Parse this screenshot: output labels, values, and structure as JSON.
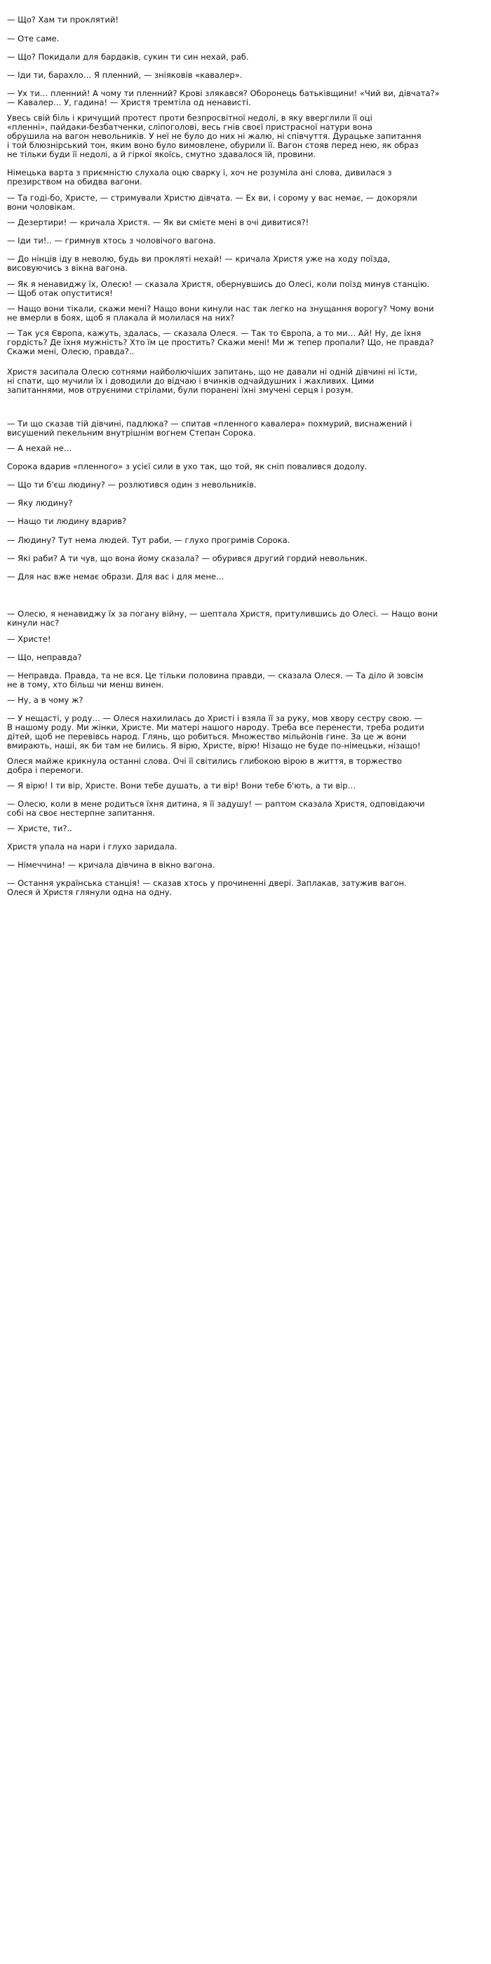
{
  "paragraphs": [
    "— Що? Хам ти проклятий!",
    "— Оте саме.",
    "— Що? Покидали для бардаків, сукин ти син нехай, раб.",
    "— Іди ти, барахло… Я пленний, — зніяковів «кавалер».",
    "— Ух ти… пленний! А чому ти пленний? Крові злякався? Оборонець батьківщини! «Чий ви, дівчата?»\n— Кавалер… У, гадина! — Христя тремтіла од ненависті.",
    "Увесь свій біль і кричущий протест проти безпросвітної недолі, в яку вверглили її оці\n«пленні», пайдаки-безбатченки, сліпоголові, весь гнів своєї пристрасної натури вона\nобрушила на вагон невольників. У неї не було до них ні жалю, ні співчуття. Дурацьке запитання\nі той блюзнірський тон, яким воно було вимовлене, обурили її. Вагон стояв перед нею, як образ\nне тільки буди її недолі, а й гіркої якоїсь, смутно здавалося їй, провини.",
    "Німецька варта з приємністю слухала оцю сварку і, хоч не розуміла ані слова, дивилася з\nпрезирством на обидва вагони.",
    "— Та годі-бо, Христе, — стримували Христю дівчата. — Ех ви, і сорому у вас немає, — докоряли\nвони чоловікам.",
    "— Дезертири! — кричала Христя. — Як ви смієте мені в очі дивитися?!",
    "— Іди ти!.. — гримнув хтось з чоловічого вагона.",
    "— До нінців іду в неволю, будь ви прокляті нехай! — кричала Христя уже на ходу поїзда,\nвисовуючись з вікна вагона.",
    "— Як я ненавиджу їх, Олесю! — сказала Христя, обернувшись до Олесі, коли поїзд минув станцію.\n— Щоб отак опуститися!",
    "— Нащо вони тікали, скажи мені? Нащо вони кинули нас так легко на знущання ворогу? Чому вони\nне вмерли в боях, щоб я плакала й молилася на них?",
    "— Так уся Європа, кажуть, здалась, — сказала Олеся. — Так то Європа, а то ми… Ай! Ну, де їхня\nгордість? Де їхня мужність? Хто їм це простить? Скажи мені! Ми ж тепер пропали? Що, не правда?\nСкажи мені, Олесю, правда?..",
    "Христя засипала Олесю сотнями найболючіших запитань, що не давали ні одній дівчині ні їсти,\nні спати, що мучили їх і доводили до відчаю і вчинків одчайдушних і жахливих. Цими\nзапитаннями, мов отруєними стрілами, були поранені їхні змучені серця і розум.",
    "— Ти що сказав тій дівчині, падлюка? — спитав «пленного кавалера» похмурий, виснажений і\nвисушений пекельним внутрішнім вогнем Степан Сорока.",
    "— А нехай не…",
    "Сорока вдарив «пленного» з усієї сили в ухо так, що той, як сніп повалився додолу.",
    "— Що ти б'єш людину? — розлютився один з невольників.",
    "— Яку людину?",
    "— Нащо ти людину вдарив?",
    "— Людину? Тут нема людей. Тут раби, — глухо прогримів Сорока.",
    "— Які раби? А ти чув, що вона йому сказала? — обурився другий гордий невольник.",
    "— Для нас вже немає образи. Для вас і для мене…",
    "— Олесю, я ненавиджу їх за погану війну, — шептала Христя, притулившись до Олесі. — Нащо вони\nкинули нас?",
    "— Христе!",
    "— Що, неправда?",
    "— Неправда. Правда, та не вся. Це тільки половина правди, — сказала Олеся. — Та діло й зовсім\nне в тому, хто більш чи менш винен.",
    "— Ну, а в чому ж?",
    "— У нещасті, у роду… — Олеся нахилилась до Христі і взяла її за руку, мов хвору сестру свою. —\nВ нашому роду. Ми жінки, Христе. Ми матері нашого народу. Треба все перенести, треба родити\nдітей, щоб не перевівсь народ. Глянь, що робиться. Множество мільйонів гине. За це ж вони\nвмирають, наші, як би там не бились. Я вірю, Христе, вірю! Нізащо не буде по-німецьки, нізащо!",
    "Олеся майже крикнула останні слова. Очі її світились глибокою вірою в життя, в торжество\nдобра і перемоги.",
    "— Я вірю! І ти вір, Христе. Вони тебе душать, а ти вір! Вони тебе б'ють, а ти вір…",
    "— Олесю, коли в мене родиться їхня дитина, я її задушу! — раптом сказала Христя, одповідаючи\nсобі на своє нестерпне запитання.",
    "— Христе, ти?..",
    "Христя упала на нари і глухо заридала.",
    "— Німеччина! — кричала дівчина в вікно вагона.",
    "— Остання українська станція! — сказав хтось у прочиненні двері. Заплакав, затужив вагон.\nОлеся й Христя глянули одна на одну."
  ]
}
